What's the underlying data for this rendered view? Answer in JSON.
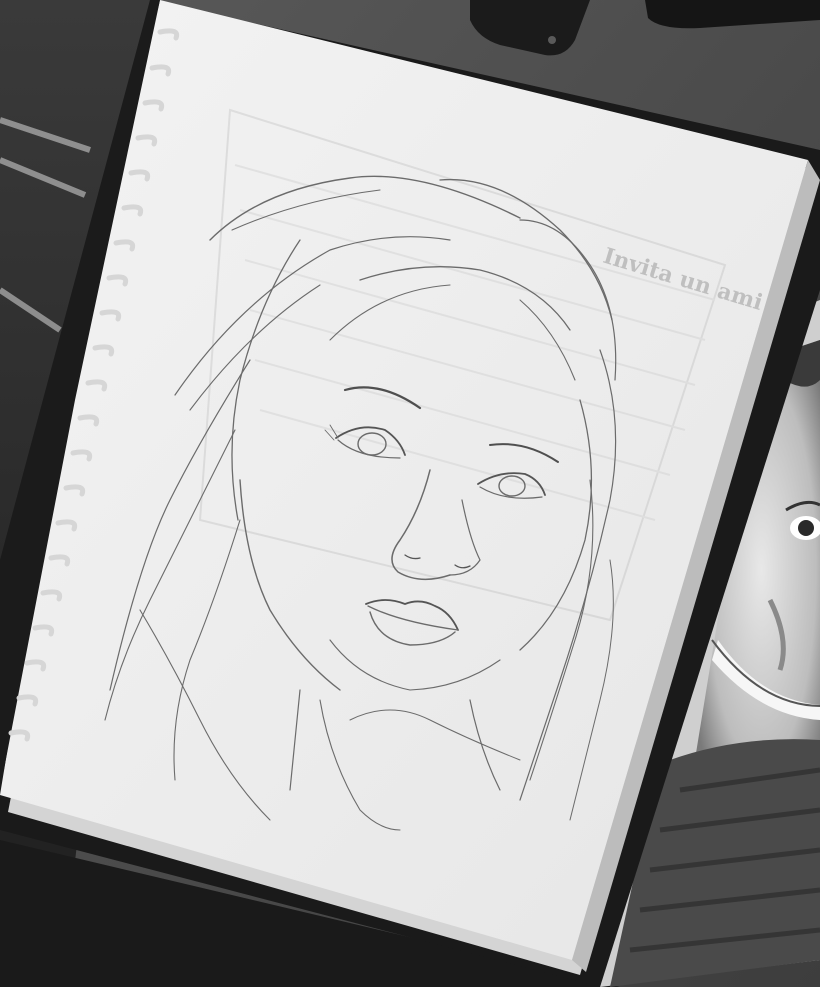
{
  "photo": {
    "colors": {
      "desk": "#4a4a4a",
      "paper": "#f1f1f1",
      "paper_shadow": "#d9d9d9",
      "pencil": "#6b6b6b",
      "binding": "#1c1c1c",
      "spiral": "#cfcfcf",
      "fabric": "#2b2b2b"
    },
    "show_through_text": "Invita un ami"
  }
}
